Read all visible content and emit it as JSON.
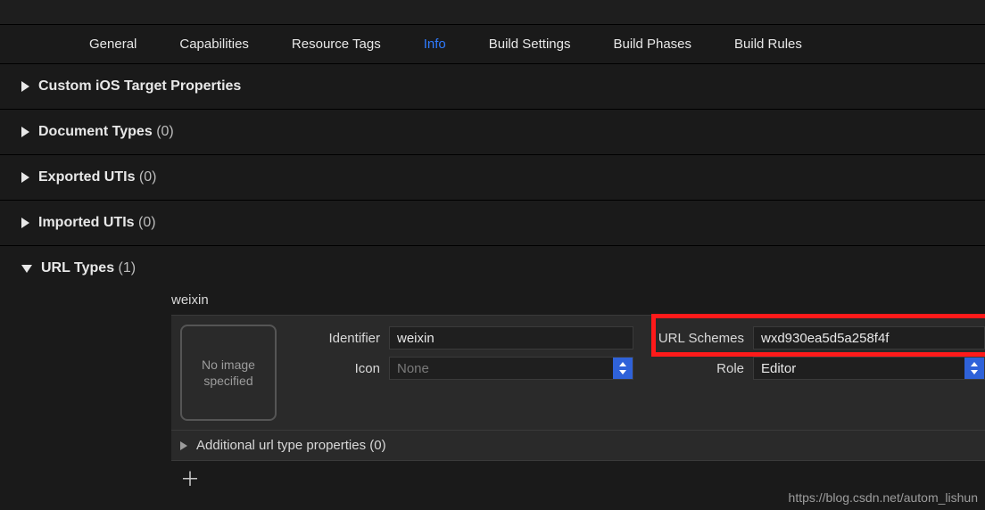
{
  "tabs": {
    "general": "General",
    "capabilities": "Capabilities",
    "resource_tags": "Resource Tags",
    "info": "Info",
    "build_settings": "Build Settings",
    "build_phases": "Build Phases",
    "build_rules": "Build Rules"
  },
  "sections": {
    "custom_ios": {
      "title": "Custom iOS Target Properties"
    },
    "document_types": {
      "title": "Document Types",
      "count": "(0)"
    },
    "exported_utis": {
      "title": "Exported UTIs",
      "count": "(0)"
    },
    "imported_utis": {
      "title": "Imported UTIs",
      "count": "(0)"
    },
    "url_types": {
      "title": "URL Types",
      "count": "(1)"
    }
  },
  "url_entry": {
    "name": "weixin",
    "image_placeholder": "No image specified",
    "identifier_label": "Identifier",
    "identifier_value": "weixin",
    "icon_label": "Icon",
    "icon_value": "None",
    "url_schemes_label": "URL Schemes",
    "url_schemes_value": "wxd930ea5d5a258f4f",
    "role_label": "Role",
    "role_value": "Editor",
    "additional": "Additional url type properties (0)"
  },
  "watermark": "https://blog.csdn.net/autom_lishun"
}
